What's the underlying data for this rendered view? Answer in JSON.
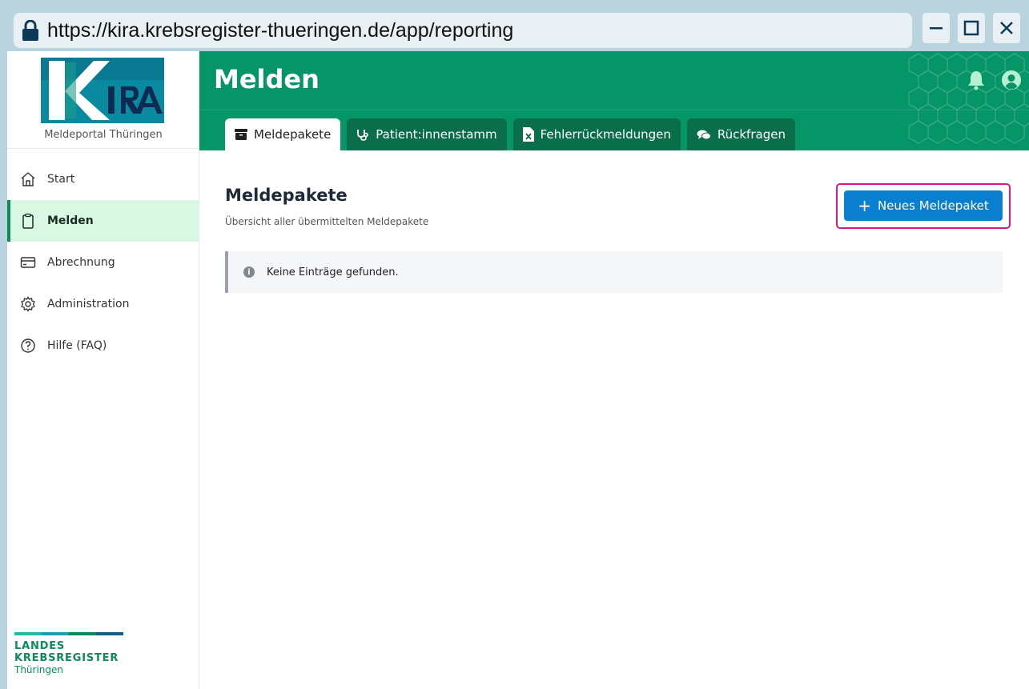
{
  "browser": {
    "url": "https://kira.krebsregister-thueringen.de/app/reporting",
    "buttons": [
      "minimize-icon",
      "maximize-icon",
      "close-icon"
    ]
  },
  "sidebar": {
    "logo_text": "KIRA",
    "logo_subtitle": "Meldeportal Thüringen",
    "items": [
      {
        "label": "Start",
        "icon": "home-icon",
        "active": false
      },
      {
        "label": "Melden",
        "icon": "clipboard-icon",
        "active": true
      },
      {
        "label": "Abrechnung",
        "icon": "credit-card-icon",
        "active": false
      },
      {
        "label": "Administration",
        "icon": "gear-icon",
        "active": false
      },
      {
        "label": "Hilfe (FAQ)",
        "icon": "help-circle-icon",
        "active": false
      }
    ],
    "footer": {
      "line1": "LANDES",
      "line2": "KREBSREGISTER",
      "line3": "Thüringen"
    }
  },
  "header": {
    "title": "Melden",
    "tabs": [
      {
        "label": "Meldepakete",
        "icon": "package-icon",
        "active": true
      },
      {
        "label": "Patient:innenstamm",
        "icon": "stethoscope-icon",
        "active": false
      },
      {
        "label": "Fehlerrückmeldungen",
        "icon": "excel-file-icon",
        "active": false
      },
      {
        "label": "Rückfragen",
        "icon": "comments-icon",
        "active": false
      }
    ]
  },
  "main": {
    "title": "Meldepakete",
    "subtitle": "Übersicht aller übermittelten Meldepakete",
    "new_button_label": "Neues Meldepaket",
    "empty_message": "Keine Einträge gefunden."
  },
  "colors": {
    "brand_green": "#069566",
    "tab_dark": "#0a6e4a",
    "active_nav_bg": "#d8f8e4",
    "primary_button": "#0b7fcf",
    "highlight": "#d21a86"
  }
}
